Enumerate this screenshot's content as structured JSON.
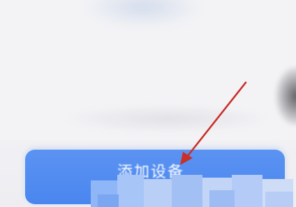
{
  "add_device_button": {
    "label": "添加设备",
    "color": "#4a86ef",
    "text_color": "#ffffff"
  },
  "annotation": {
    "icon": "arrow-icon",
    "color": "#c8302a"
  },
  "background_color": "#f3f3f6"
}
